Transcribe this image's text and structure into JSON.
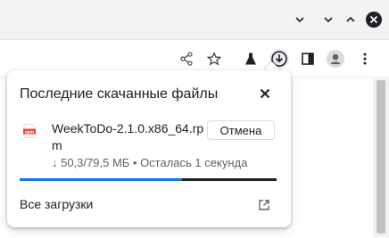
{
  "titlebar": {
    "buttons": [
      {
        "name": "tab-search-icon"
      },
      {
        "name": "minimize-icon"
      },
      {
        "name": "maximize-icon"
      },
      {
        "name": "close-window-icon"
      }
    ]
  },
  "toolbar": {
    "icons": [
      "share-icon",
      "bookmark-star-icon",
      "labs-flask-icon",
      "download-icon",
      "side-panel-icon",
      "profile-avatar-icon",
      "kebab-menu-icon"
    ]
  },
  "downloads": {
    "title": "Последние скачанные файлы",
    "file": {
      "name": "WeekToDo-2.1.0.x86_64.rpm",
      "type_badge": "rpm",
      "status": "↓ 50,3/79,5 МБ • Осталась 1 секунда",
      "progress": 0.633
    },
    "cancel_label": "Отмена",
    "all_downloads_label": "Все загрузки",
    "colors": {
      "progress": "#1a73e8",
      "badge": "#e8453c"
    }
  }
}
